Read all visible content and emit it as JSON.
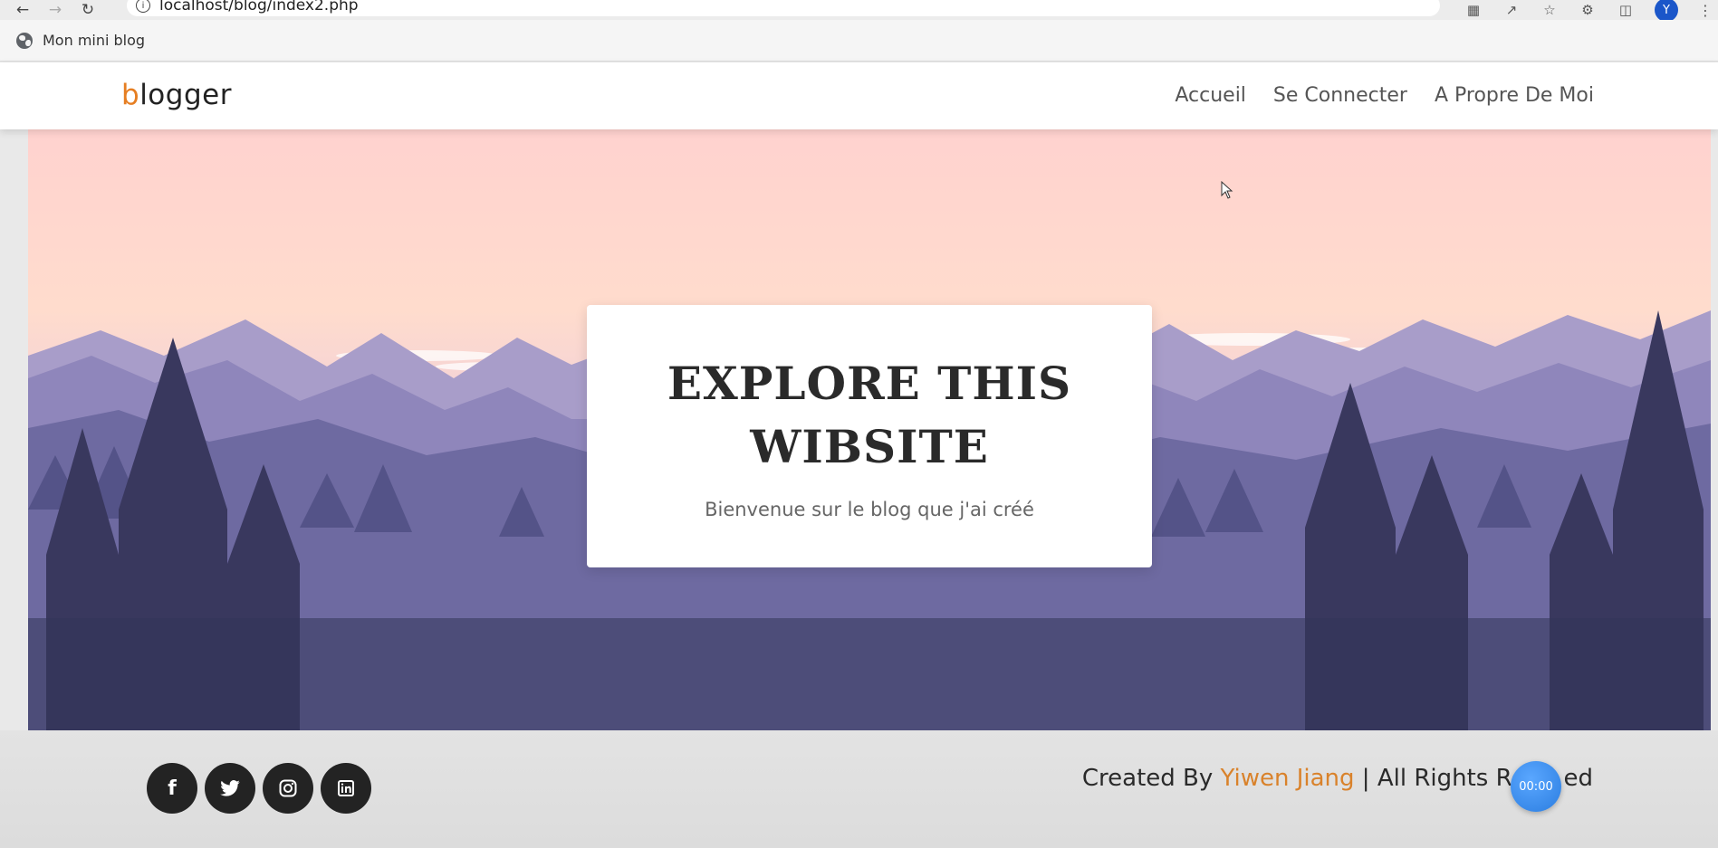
{
  "browser": {
    "url": "localhost/blog/index2.php",
    "profile_initial": "Y",
    "bookmark_label": "Mon mini blog"
  },
  "site": {
    "logo_accent": "b",
    "logo_rest": "logger",
    "accent_color": "#e67e22",
    "nav": [
      "Accueil",
      "Se Connecter",
      "A Propre De Moi"
    ]
  },
  "hero": {
    "title_line1": "EXPLORE THIS",
    "title_line2": "WIBSITE",
    "subtitle": "Bienvenue sur le blog que j'ai créé"
  },
  "footer": {
    "socials": [
      "facebook-icon",
      "twitter-icon",
      "instagram-icon",
      "linkedin-icon"
    ],
    "credit_prefix": "Created By ",
    "credit_author": "Yiwen Jiang",
    "credit_suffix": " | All Rights Re",
    "credit_tail": "ed",
    "timer": "00:00"
  }
}
